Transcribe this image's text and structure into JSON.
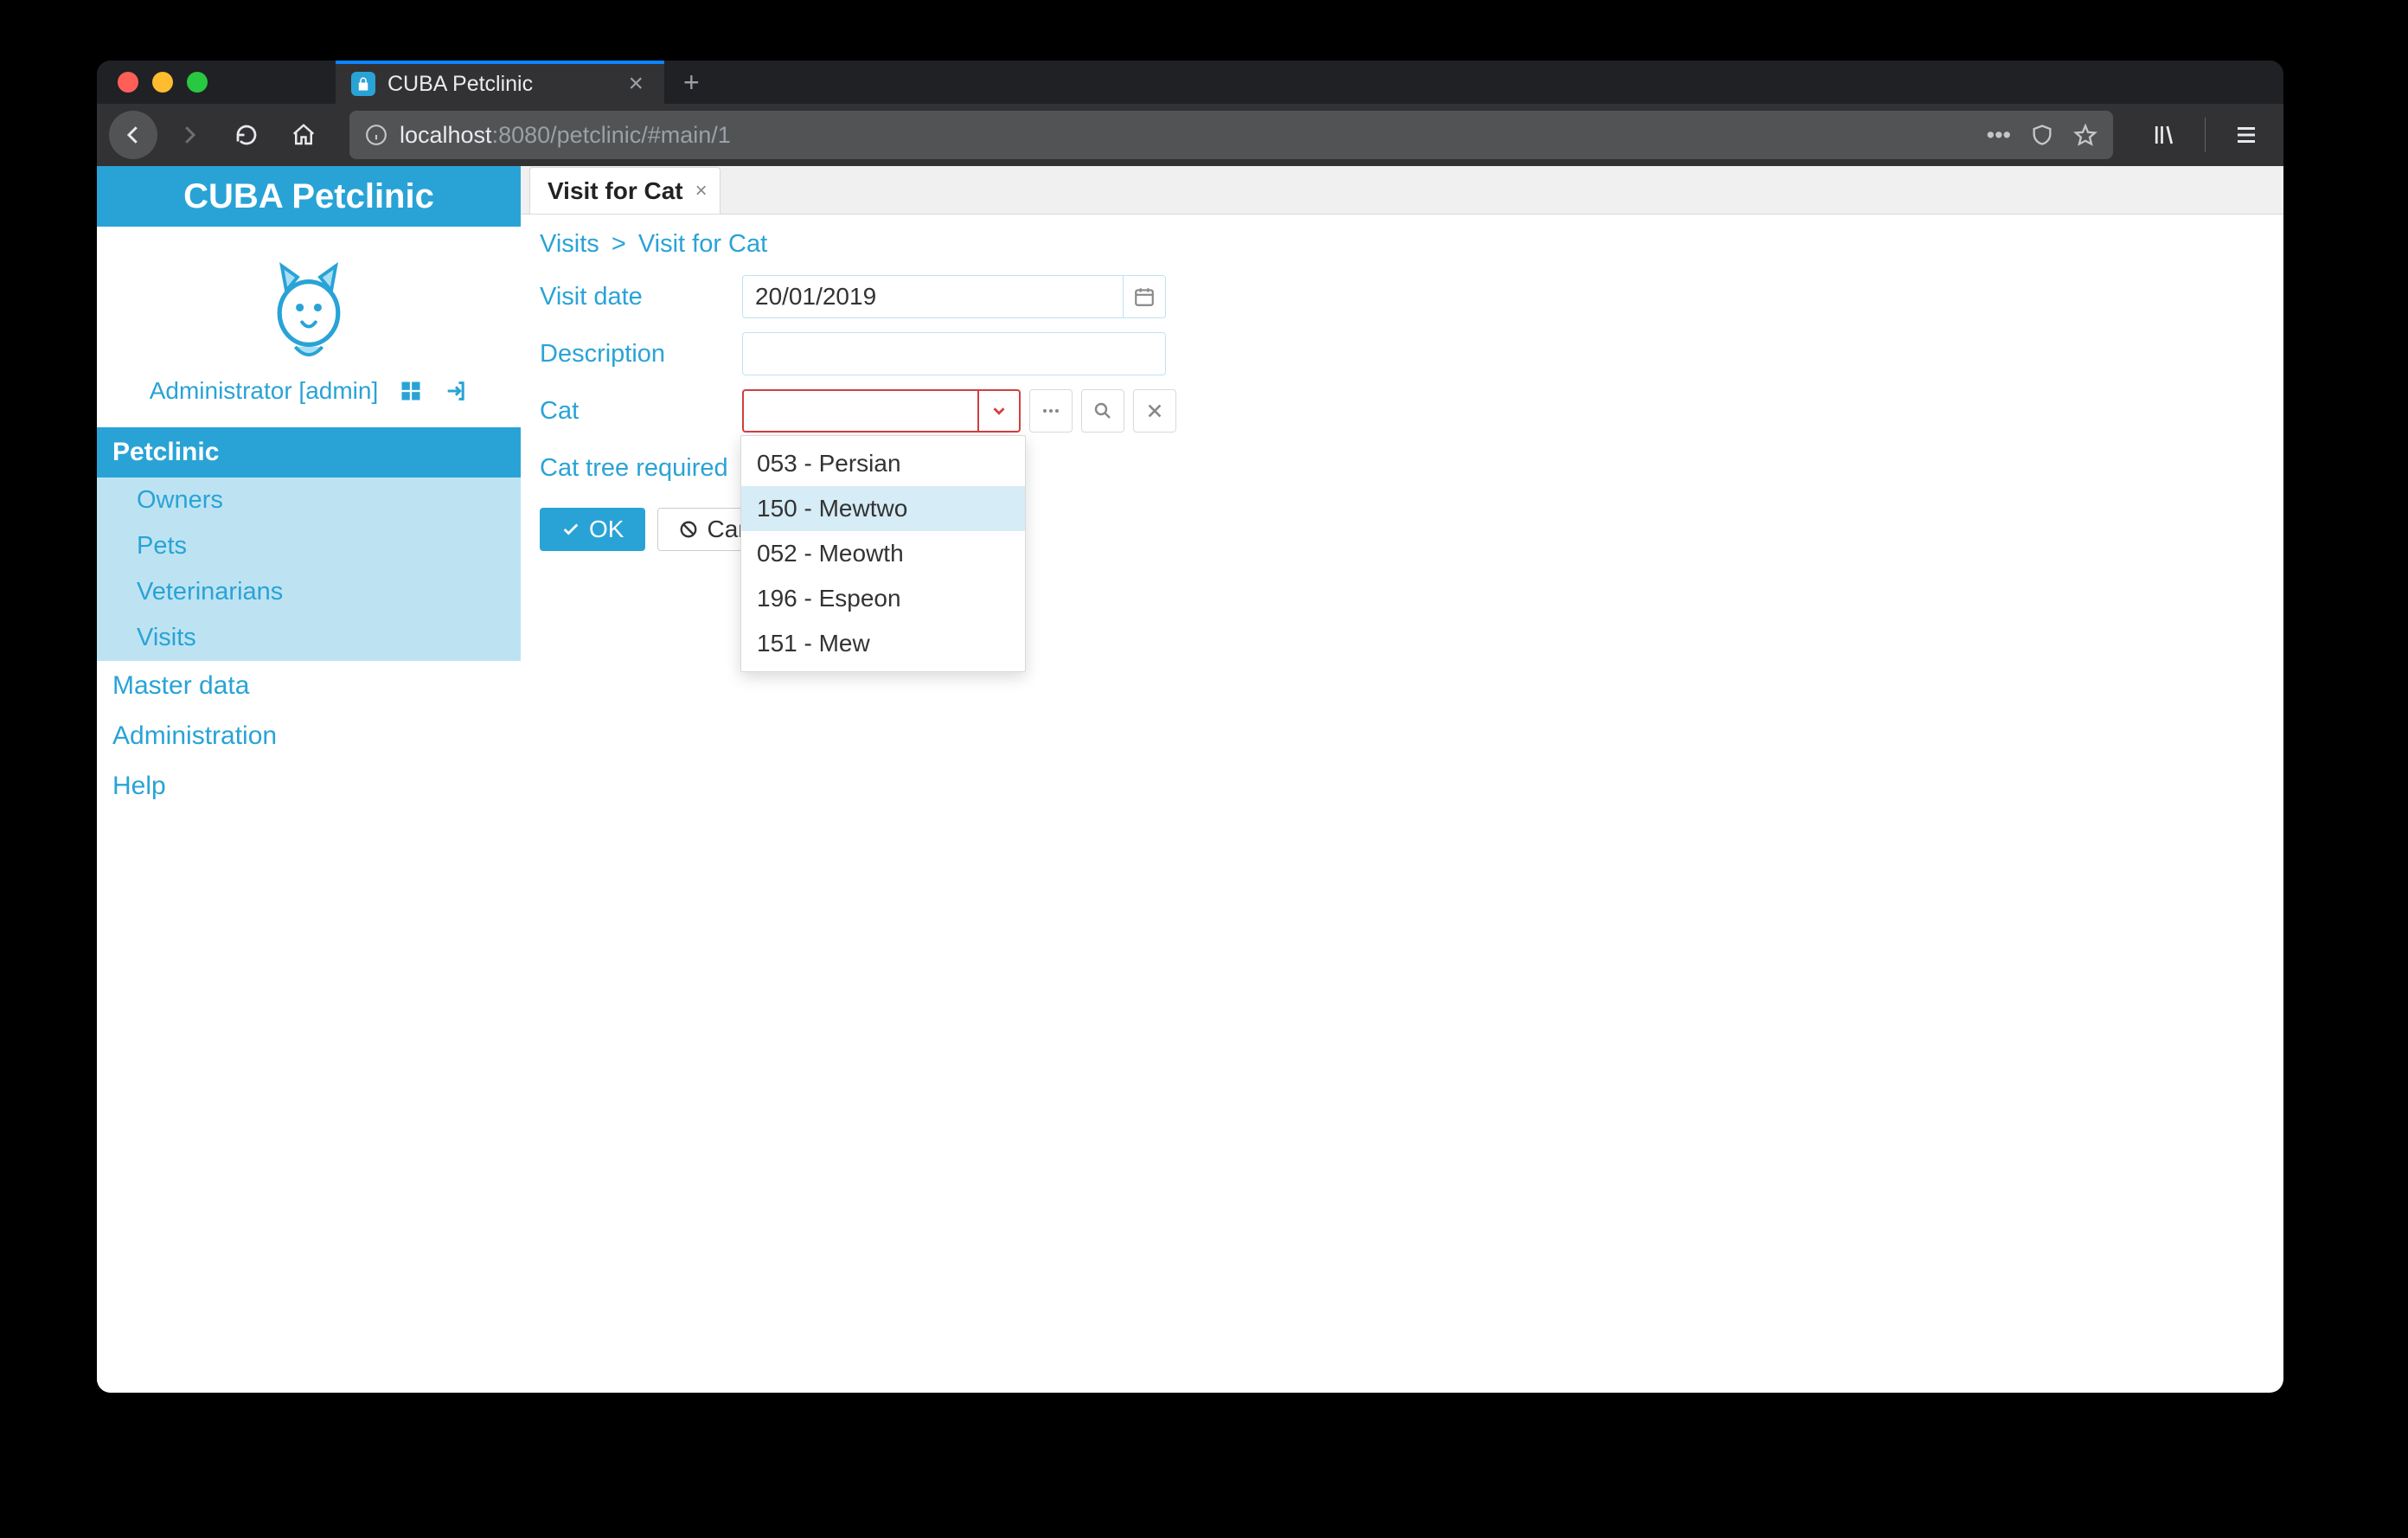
{
  "browser": {
    "tab_title": "CUBA Petclinic",
    "url_host": "localhost",
    "url_port": ":8080",
    "url_path": "/petclinic/#main/1"
  },
  "brand": "CUBA Petclinic",
  "user": {
    "display": "Administrator [admin]"
  },
  "sidebar": {
    "items": [
      {
        "label": "Petclinic",
        "active": true
      },
      {
        "label": "Owners",
        "sub": true
      },
      {
        "label": "Pets",
        "sub": true
      },
      {
        "label": "Veterinarians",
        "sub": true
      },
      {
        "label": "Visits",
        "sub": true
      },
      {
        "label": "Master data"
      },
      {
        "label": "Administration"
      },
      {
        "label": "Help"
      }
    ]
  },
  "page": {
    "tab_label": "Visit for Cat",
    "breadcrumb": {
      "root": "Visits",
      "sep": ">",
      "current": "Visit for Cat"
    }
  },
  "form": {
    "visit_date": {
      "label": "Visit date",
      "value": "20/01/2019"
    },
    "description": {
      "label": "Description",
      "value": ""
    },
    "cat": {
      "label": "Cat",
      "value": ""
    },
    "cat_tree_required": {
      "label": "Cat tree required"
    },
    "dropdown": {
      "options": [
        "053 - Persian",
        "150 - Mewtwo",
        "052 - Meowth",
        "196 - Espeon",
        "151 - Mew"
      ],
      "highlighted_index": 1
    },
    "buttons": {
      "ok": "OK",
      "cancel": "Cancel"
    }
  }
}
